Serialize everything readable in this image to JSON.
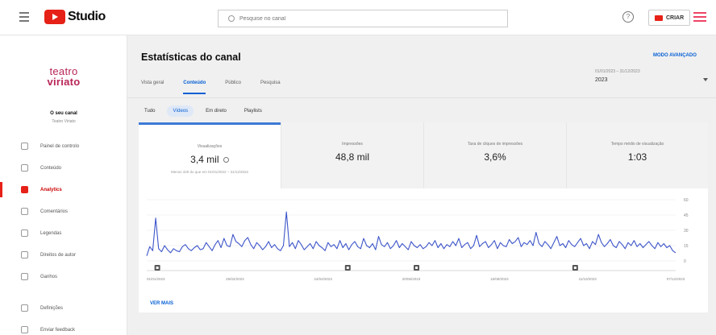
{
  "topbar": {
    "app_name": "Studio",
    "search_placeholder": "Pesquise no canal",
    "create_label": "CRIAR"
  },
  "sidebar": {
    "brand_line1": "teatro",
    "brand_line2": "viriato",
    "channel_title": "O seu canal",
    "channel_name": "Teatro Viriato",
    "items": [
      {
        "label": "Painel de controlo"
      },
      {
        "label": "Conteúdo"
      },
      {
        "label": "Analytics"
      },
      {
        "label": "Comentários"
      },
      {
        "label": "Legendas"
      },
      {
        "label": "Direitos de autor"
      },
      {
        "label": "Ganhos"
      }
    ],
    "bottom_items": [
      {
        "label": "Definições"
      },
      {
        "label": "Enviar feedback"
      }
    ]
  },
  "main": {
    "title": "Estatísticas do canal",
    "advanced_mode": "MODO AVANÇADO",
    "date_range": "01/01/2023 – 31/12/2023",
    "date_year": "2023",
    "tabs": [
      {
        "label": "Vista geral"
      },
      {
        "label": "Conteúdo"
      },
      {
        "label": "Público"
      },
      {
        "label": "Pesquisa"
      }
    ],
    "subtabs": [
      {
        "label": "Tudo"
      },
      {
        "label": "Vídeos"
      },
      {
        "label": "Em direto"
      },
      {
        "label": "Playlists"
      }
    ],
    "metrics": [
      {
        "label": "Visualizações",
        "value": "3,4 mil",
        "sub": "Menos 329 do que em 01/01/2022 – 31/12/2022"
      },
      {
        "label": "Impressões",
        "value": "48,8 mil"
      },
      {
        "label": "Taxa de cliques de impressões",
        "value": "3,6%"
      },
      {
        "label": "Tempo médio de visualização",
        "value": "1:03"
      }
    ],
    "see_more": "VER MAIS"
  },
  "colors": {
    "accent": "#065fd4",
    "line": "#3d55c9",
    "brand": "#b82557",
    "youtube_red": "#e62117"
  },
  "chart_data": {
    "type": "line",
    "title": "",
    "xlabel": "",
    "ylabel": "",
    "ylim": [
      0,
      60
    ],
    "yticks": [
      "0",
      "15",
      "30",
      "45",
      "60"
    ],
    "xticks": [
      "01/01/2023",
      "26/02/2023",
      "24/04/2023",
      "20/06/2023",
      "16/08/2023",
      "11/10/2023",
      "07/12/2023"
    ],
    "series": [
      {
        "values": [
          5,
          14,
          10,
          42,
          12,
          9,
          15,
          11,
          8,
          12,
          10,
          9,
          14,
          16,
          12,
          10,
          13,
          15,
          11,
          12,
          18,
          14,
          10,
          16,
          20,
          13,
          22,
          15,
          14,
          26,
          19,
          17,
          14,
          20,
          23,
          16,
          12,
          18,
          15,
          11,
          14,
          19,
          13,
          16,
          12,
          10,
          15,
          48,
          14,
          18,
          12,
          20,
          16,
          11,
          14,
          17,
          12,
          19,
          15,
          13,
          10,
          18,
          14,
          16,
          12,
          20,
          13,
          17,
          11,
          16,
          19,
          14,
          12,
          22,
          15,
          13,
          17,
          11,
          24,
          16,
          14,
          18,
          12,
          15,
          20,
          13,
          17,
          14,
          11,
          19,
          15,
          13,
          16,
          12,
          14,
          18,
          15,
          20,
          13,
          17,
          12,
          16,
          14,
          19,
          15,
          22,
          13,
          16,
          18,
          12,
          15,
          25,
          14,
          17,
          19,
          13,
          16,
          20,
          12,
          18,
          15,
          14,
          21,
          17,
          19,
          23,
          14,
          18,
          16,
          20,
          15,
          28,
          17,
          14,
          19,
          16,
          12,
          18,
          24,
          15,
          17,
          13,
          20,
          16,
          14,
          18,
          22,
          15,
          17,
          12,
          19,
          16,
          26,
          18,
          14,
          17,
          21,
          15,
          13,
          19,
          16,
          12,
          18,
          15,
          20,
          14,
          17,
          13,
          16,
          19,
          15,
          12,
          18,
          14,
          17,
          13,
          15,
          10,
          8
        ]
      }
    ],
    "markers": [
      2,
      38,
      51,
      81
    ]
  }
}
